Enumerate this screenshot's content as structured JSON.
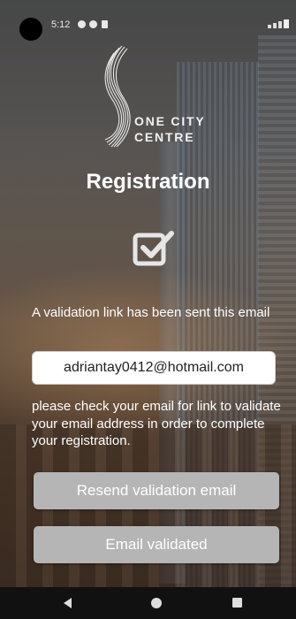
{
  "status_bar": {
    "time": "5:12",
    "icons": [
      "notification-a-icon",
      "notification-p-icon",
      "notification-lock-icon"
    ],
    "right_icons": [
      "wifi-icon",
      "signal-icon",
      "battery-icon"
    ]
  },
  "brand": {
    "line1": "ONE CITY",
    "line2": "CENTRE"
  },
  "page": {
    "title": "Registration"
  },
  "validation": {
    "sent_message": "A validation link has been sent this email",
    "email": "adriantay0412@hotmail.com",
    "instructions": "please check your email for link to validate your email address in order to complete your registration."
  },
  "buttons": {
    "resend": "Resend validation email",
    "validated": "Email validated"
  },
  "nav": {
    "back": "back-icon",
    "home": "home-icon",
    "recent": "recent-apps-icon"
  },
  "colors": {
    "button_bg": "#b5b5b5",
    "text": "#ffffff",
    "nav_bg": "#111111"
  }
}
